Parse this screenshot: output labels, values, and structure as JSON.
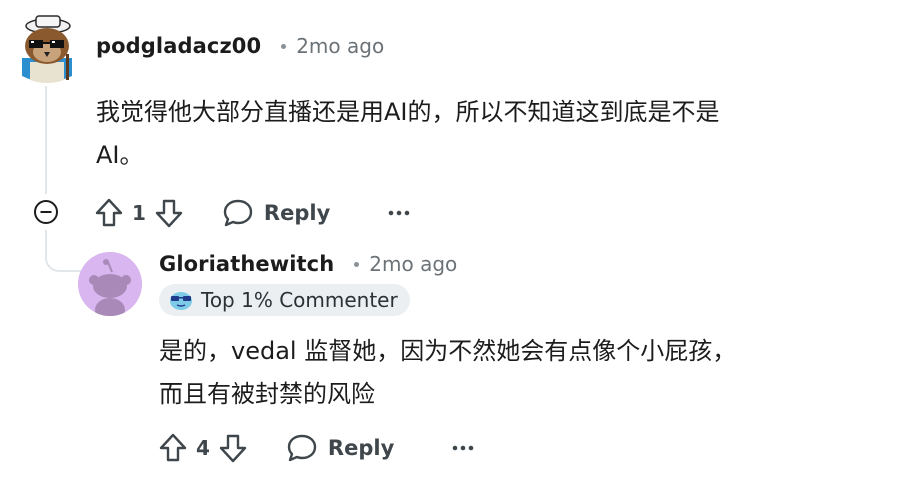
{
  "comment": {
    "username": "podgladacz00",
    "timestamp": "2mo ago",
    "body_lines": [
      "我觉得他大部分直播还是用AI的，所以不知道这到底是不是",
      "AI。"
    ],
    "vote_count": "1",
    "reply_label": "Reply",
    "avatar_icon": "owl-sunglasses-avatar"
  },
  "reply": {
    "username": "Gloriathewitch",
    "timestamp": "2mo ago",
    "flair": "Top 1% Commenter",
    "flair_icon": "sunglasses-emoji-icon",
    "body_lines": [
      "是的，vedal 监督她，因为不然她会有点像个小屁孩，",
      "而且有被封禁的风险"
    ],
    "vote_count": "4",
    "reply_label": "Reply",
    "avatar_icon": "snoo-avatar",
    "avatar_bg": "#d9b6ef"
  },
  "colors": {
    "text": "#1c1c1c",
    "meta": "#6b7378",
    "action": "#3f474c",
    "thread": "#e3e6e8",
    "flair_bg": "#eceff1"
  }
}
